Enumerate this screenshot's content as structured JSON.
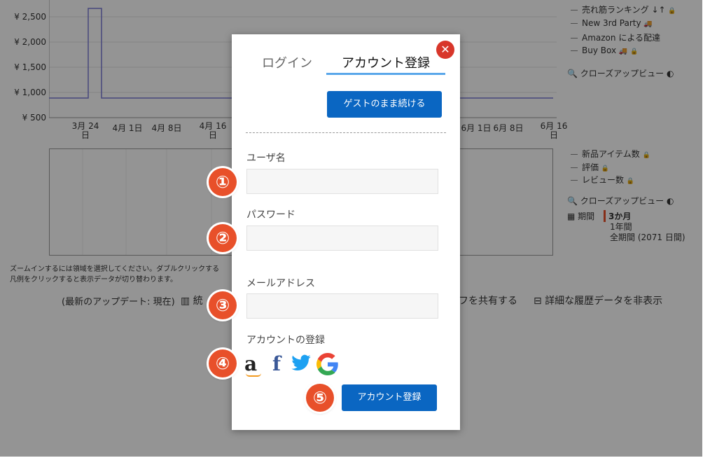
{
  "chart_bg": {
    "y_ticks": [
      "¥ 2,500",
      "¥ 2,000",
      "¥ 1,500",
      "¥ 1,000",
      "¥ 500"
    ],
    "x_ticks": [
      "3月 24\n日",
      "4月 1日",
      "4月 8日",
      "4月 16\n日",
      "6月 1日",
      "6月 8日",
      "6月 16\n日"
    ],
    "legend_top": [
      "売れ筋ランキング",
      "New 3rd Party",
      "Amazon による配達",
      "Buy Box"
    ],
    "closeup_label_1": "クローズアップビュー",
    "legend_bottom": [
      "新品アイテム数",
      "評価",
      "レビュー数"
    ],
    "closeup_label_2": "クローズアップビュー",
    "period_label": "期間",
    "period_options": [
      "3か月",
      "1年間",
      "全期間 (2071 日間)"
    ],
    "zoom_hint_1": "ズームインするには領域を選択してください。ダブルクリックする",
    "zoom_hint_2": "凡例をクリックすると表示データが切り替わります。",
    "last_update": "(最新のアップデート: 現在)",
    "stats_link_partial": "統",
    "share_link_partial": "フを共有する",
    "hide_history": "詳細な履歴データを非表示",
    "series_color": "#7b7bd6"
  },
  "modal": {
    "tabs": [
      "ログイン",
      "アカウント登録"
    ],
    "active_tab": 1,
    "guest_button": "ゲストのまま続ける",
    "username_label": "ユーザ名",
    "username_value": "",
    "password_label": "パスワード",
    "password_value": "",
    "email_label": "メールアドレス",
    "email_value": "",
    "social_label": "アカウントの登録",
    "social_icons": [
      "amazon-icon",
      "facebook-icon",
      "twitter-icon",
      "google-icon"
    ],
    "register_button": "アカウント登録",
    "close_icon": "close-icon",
    "accent_color": "#0a66c2",
    "close_color": "#d8362a"
  },
  "annotations": [
    "①",
    "②",
    "③",
    "④",
    "⑤"
  ]
}
